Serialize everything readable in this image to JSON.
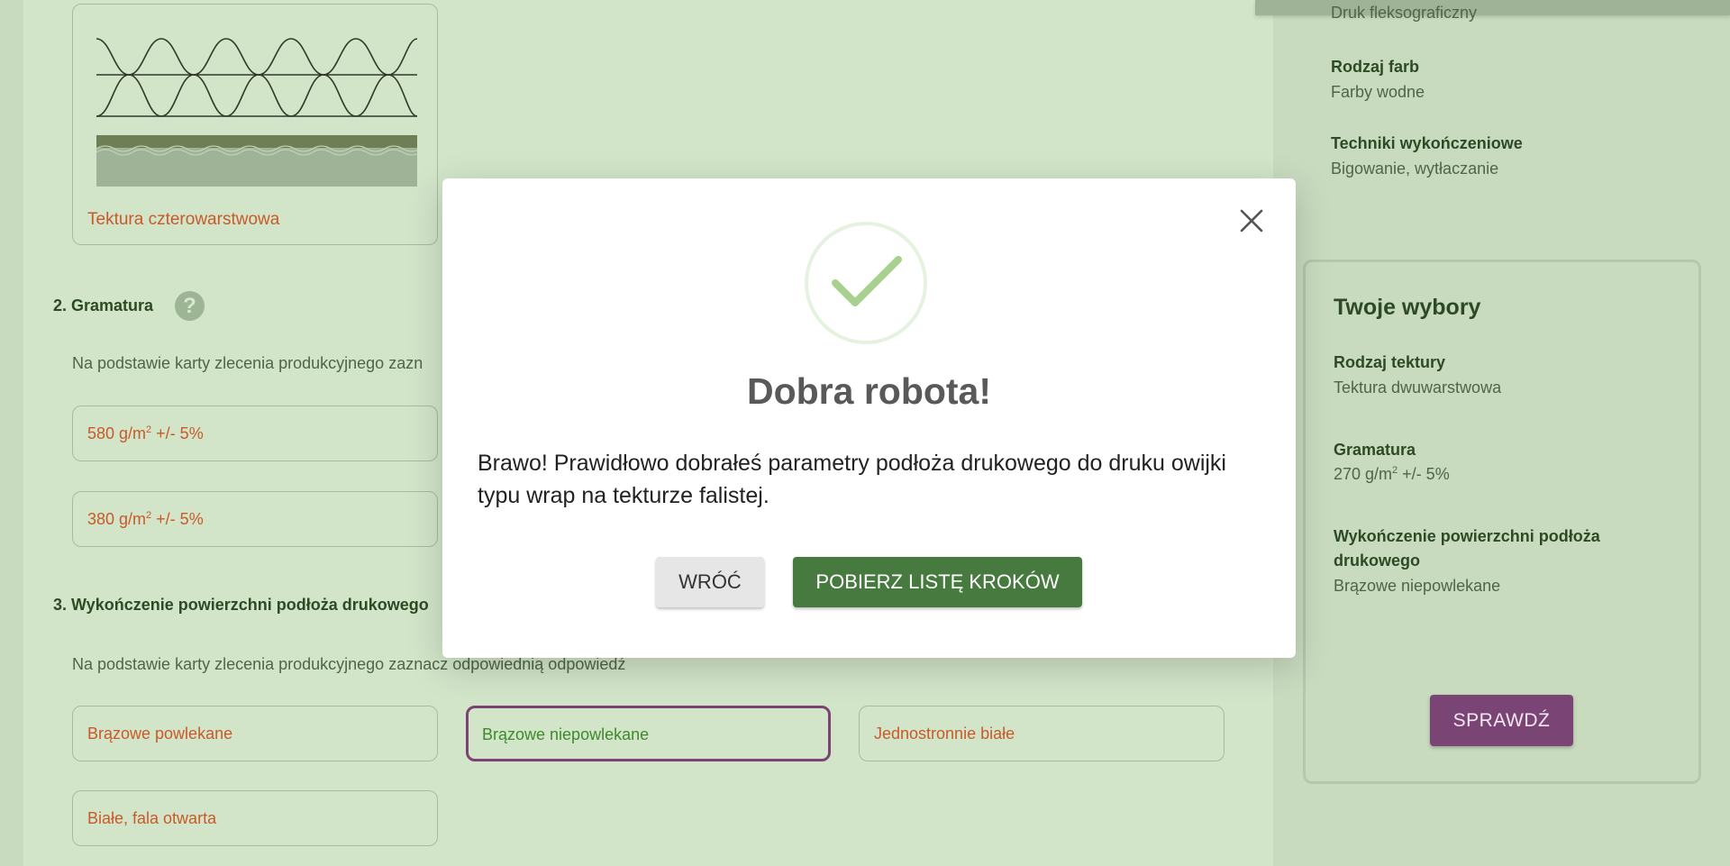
{
  "main": {
    "card_selected_label": "Tektura czterowarstwowa",
    "section2": {
      "title": "2. Gramatura",
      "help": "?",
      "instruction": "Na podstawie karty zlecenia produkcyjnego zazn",
      "options": [
        {
          "prefix": "580 g/m",
          "sup": "2",
          "suffix": " +/- 5%"
        },
        {
          "prefix": "380 g/m",
          "sup": "2",
          "suffix": " +/- 5%"
        }
      ]
    },
    "section3": {
      "title": "3. Wykończenie powierzchni podłoża drukowego",
      "instruction": "Na podstawie karty zlecenia produkcyjnego zaznacz odpowiednią odpowiedź",
      "options": [
        "Brązowe powlekane",
        "Brązowe niepowlekane",
        "Jednostronnie białe",
        "Białe, fala otwarta"
      ],
      "selected_index": 1
    }
  },
  "sidebar": {
    "top_value_cut": "Druk fleksograficzny",
    "ink_label": "Rodzaj farb",
    "ink_value": "Farby wodne",
    "finish_label": "Techniki wykończeniowe",
    "finish_value": "Bigowanie, wytłaczanie",
    "choices": {
      "title": "Twoje wybory",
      "board_label": "Rodzaj tektury",
      "board_value": "Tektura dwuwarstwowa",
      "grammage_label": "Gramatura",
      "grammage_prefix": "270 g/m",
      "grammage_sup": "2",
      "grammage_suffix": " +/- 5%",
      "surface_label_1": "Wykończenie powierzchni podłoża",
      "surface_label_2": "drukowego",
      "surface_value": "Brązowe niepowlekane",
      "check_button": "SPRAWDŹ"
    }
  },
  "modal": {
    "title": "Dobra robota!",
    "message": "Brawo! Prawidłowo dobrałeś parametry podłoża drukowego do druku owijki typu wrap na tekturze falistej.",
    "back_button": "WRÓĆ",
    "download_button": "POBIERZ LISTĘ KROKÓW"
  },
  "colors": {
    "accent_green": "#477a3f",
    "accent_purple": "#7a4575",
    "option_text": "#c85a2a"
  }
}
